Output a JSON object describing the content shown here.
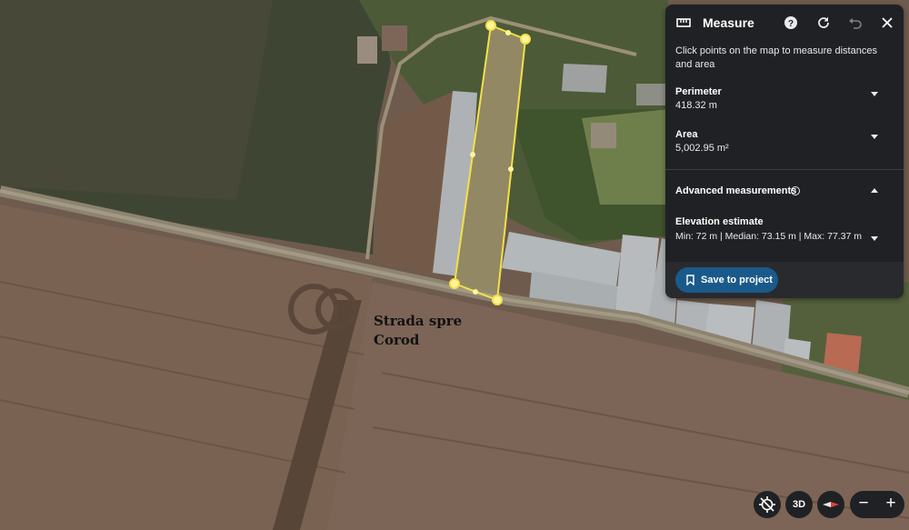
{
  "map": {
    "label": "Strada spre\nCorod"
  },
  "panel": {
    "title": "Measure",
    "instructions": "Click points on the map to measure distances and area",
    "perimeter": {
      "label": "Perimeter",
      "value": "418.32 m"
    },
    "area": {
      "label": "Area",
      "value": "5,002.95 m²"
    },
    "advanced": {
      "label": "Advanced measurements"
    },
    "elevation": {
      "label": "Elevation estimate",
      "value": "Min: 72 m | Median: 73.15 m | Max: 77.37 m"
    },
    "save_label": "Save to project",
    "icons": [
      "ruler-icon",
      "help-icon",
      "refresh-icon",
      "undo-icon",
      "close-icon",
      "info-icon",
      "bookmark-icon"
    ]
  },
  "controls": {
    "threed_label": "3D",
    "zoom_out": "−",
    "zoom_in": "+"
  },
  "colors": {
    "panel_bg": "#202124",
    "accent_button": "#1a5a8a",
    "polygon": "#f3e04a"
  }
}
